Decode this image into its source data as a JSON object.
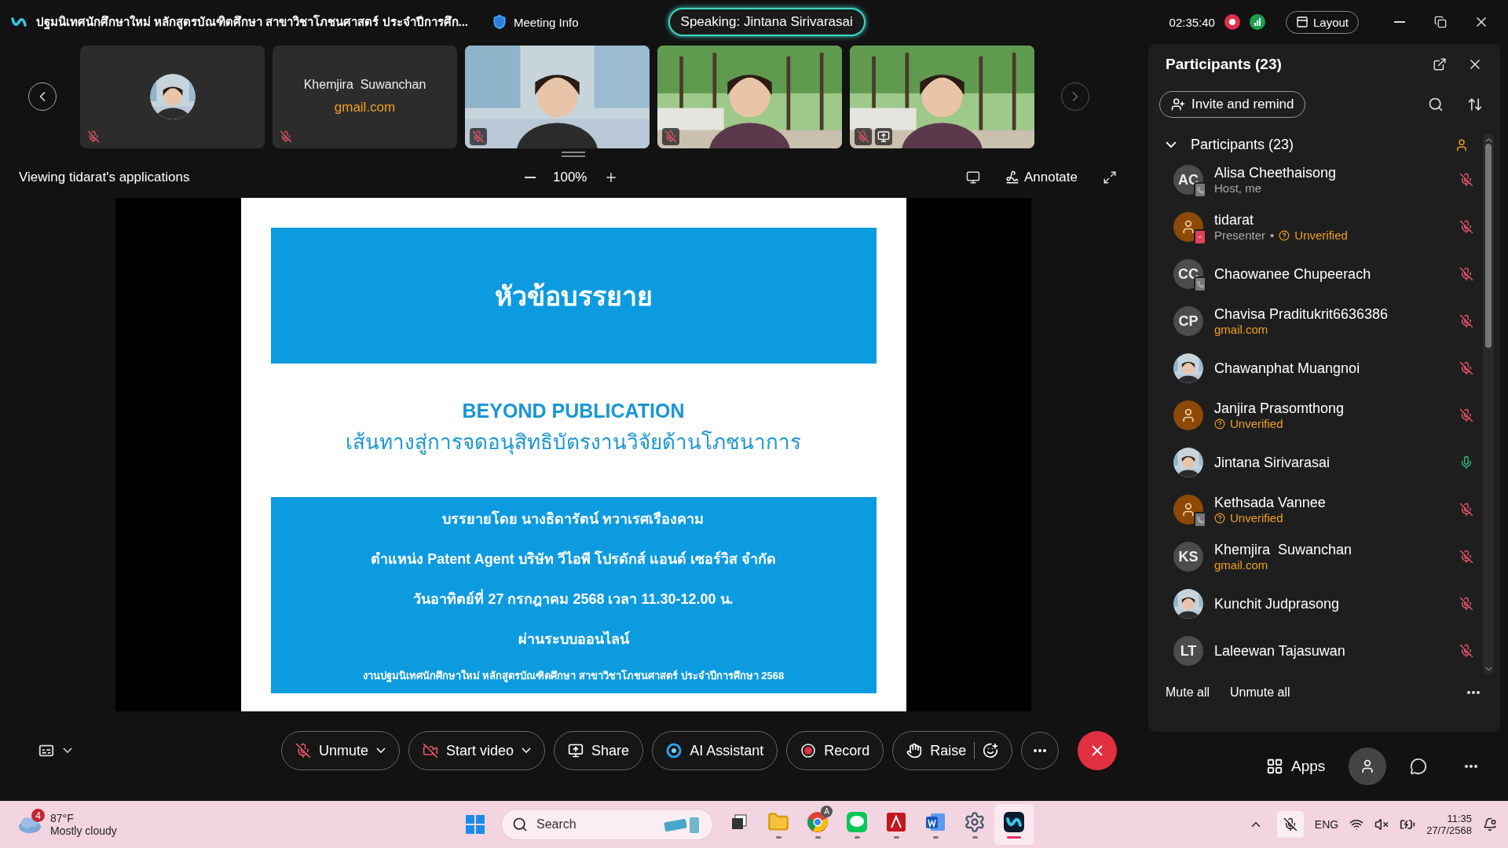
{
  "window": {
    "title": "ปฐมนิเทศนักศึกษาใหม่ หลักสูตรบัณฑิตศึกษา สาขาวิชาโภชนศาสตร์ ประจำปีการศึก...",
    "meeting_info": "Meeting Info",
    "speaking": "Speaking: Jintana Sirivarasai",
    "timer": "02:35:40",
    "layout_button": "Layout"
  },
  "thumbnails": [
    {
      "kind": "avatar",
      "muted": true
    },
    {
      "kind": "name",
      "name": "Khemjira  Suwanchan",
      "email": "gmail.com",
      "muted": true
    },
    {
      "kind": "video",
      "muted": true
    },
    {
      "kind": "video",
      "muted": true
    },
    {
      "kind": "video",
      "muted": true,
      "sharing": true
    }
  ],
  "share_bar": {
    "viewing": "Viewing tidarat's applications",
    "zoom": "100%",
    "annotate": "Annotate"
  },
  "slide": {
    "title": "หัวข้อบรรยาย",
    "heading": "BEYOND PUBLICATION",
    "subheading": "เส้นทางสู่การจดอนุสิทธิบัตรงานวิจัยด้านโภชนาการ",
    "lines": [
      "บรรยายโดย นางธิดารัตน์ ทวาเรศเรืองคาม",
      "ตำแหน่ง Patent Agent  บริษัท วีไอพี โปรดักส์ แอนด์ เซอร์วิส จำกัด",
      "วันอาทิตย์ที่ 27 กรกฎาคม 2568 เวลา 11.30-12.00 น.",
      "ผ่านระบบออนไลน์"
    ],
    "footer": "งานปฐมนิเทศนักศึกษาใหม่ หลักสูตรบัณฑิตศึกษา สาขาวิชาโภชนศาสตร์ ประจำปีการศึกษา 2568"
  },
  "panel": {
    "title": "Participants (23)",
    "invite_button": "Invite and remind",
    "group": {
      "label": "Participants (23)",
      "expanded": true
    },
    "participants": [
      {
        "name": "Alisa Cheethaisong",
        "kind": "initials",
        "initials": "AC",
        "on_device": true,
        "muted": true,
        "subtitle": [
          {
            "kind": "plain",
            "text": "Host, me"
          }
        ]
      },
      {
        "name": "tidarat",
        "kind": "guest",
        "sharing": true,
        "muted": true,
        "subtitle": [
          {
            "kind": "plain",
            "text": "Presenter"
          },
          {
            "kind": "separator",
            "text": "•"
          },
          {
            "kind": "unverified",
            "text": "Unverified"
          }
        ]
      },
      {
        "name": "Chaowanee Chupeerach",
        "kind": "initials",
        "initials": "CC",
        "on_device": true,
        "muted": true
      },
      {
        "name": "Chavisa Praditukrit6636386",
        "kind": "initials",
        "initials": "CP",
        "muted": true,
        "subtitle": [
          {
            "kind": "email",
            "text": "gmail.com"
          }
        ]
      },
      {
        "name": "Chawanphat Muangnoi",
        "muted": true
      },
      {
        "name": "Janjira Prasomthong",
        "kind": "guest",
        "muted": true,
        "subtitle": [
          {
            "kind": "unverified",
            "text": "Unverified"
          }
        ]
      },
      {
        "name": "Jintana Sirivarasai",
        "muted": false
      },
      {
        "name": "Kethsada Vannee",
        "kind": "guest",
        "on_device": true,
        "muted": true,
        "subtitle": [
          {
            "kind": "unverified",
            "text": "Unverified"
          }
        ]
      },
      {
        "name": "Khemjira  Suwanchan",
        "kind": "initials",
        "initials": "KS",
        "muted": true,
        "subtitle": [
          {
            "kind": "email",
            "text": "gmail.com"
          }
        ]
      },
      {
        "name": "Kunchit Judprasong",
        "muted": true
      },
      {
        "name": "Laleewan Tajasuwan",
        "kind": "initials",
        "initials": "LT",
        "muted": true
      }
    ],
    "mute_all": "Mute all",
    "unmute_all": "Unmute all"
  },
  "toolbar": {
    "buttons": [
      {
        "kind": "unmute",
        "label": "Unmute",
        "dropdown": true
      },
      {
        "kind": "video",
        "label": "Start video",
        "dropdown": true
      },
      {
        "kind": "share",
        "label": "Share"
      },
      {
        "kind": "ai",
        "label": "AI Assistant"
      },
      {
        "kind": "record",
        "label": "Record"
      },
      {
        "kind": "raise",
        "label": "Raise"
      }
    ],
    "apps": "Apps"
  },
  "taskbar": {
    "weather_badge": "4",
    "temperature": "87°F",
    "weather": "Mostly cloudy",
    "search_placeholder": "Search",
    "apps": [
      {
        "kind": "taskview",
        "running": false,
        "active": false
      },
      {
        "kind": "folder",
        "running": true,
        "active": false
      },
      {
        "kind": "browser",
        "running": true,
        "active": false,
        "badge": "A"
      },
      {
        "kind": "chat",
        "running": true,
        "active": false
      },
      {
        "kind": "pdf",
        "running": true,
        "active": false
      },
      {
        "kind": "word",
        "running": true,
        "active": false
      },
      {
        "kind": "settings",
        "running": true,
        "active": false
      },
      {
        "kind": "meeting",
        "running": true,
        "active": true
      }
    ],
    "language": "ENG",
    "time": "11:35",
    "date": "27/7/2568"
  }
}
